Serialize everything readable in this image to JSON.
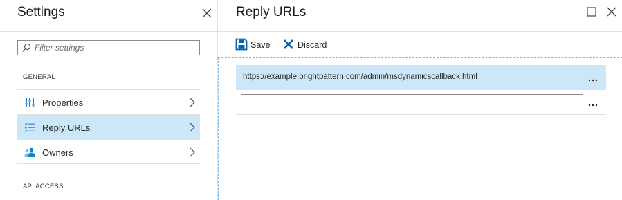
{
  "settings": {
    "title": "Settings",
    "filter_placeholder": "Filter settings",
    "general_label": "GENERAL",
    "api_access_label": "API ACCESS",
    "menu": [
      {
        "label": "Properties",
        "icon": "properties-icon",
        "selected": false
      },
      {
        "label": "Reply URLs",
        "icon": "list-icon",
        "selected": true
      },
      {
        "label": "Owners",
        "icon": "owners-icon",
        "selected": false
      }
    ]
  },
  "reply_urls": {
    "title": "Reply URLs",
    "toolbar": {
      "save_label": "Save",
      "discard_label": "Discard"
    },
    "urls": [
      {
        "value": "https://example.brightpattern.com/admin/msdynamicscallback.html"
      }
    ],
    "new_url_value": "",
    "ellipsis": "..."
  },
  "colors": {
    "accent": "#0072c6",
    "selected_bg": "#cce8f8",
    "owners_icon": "#0f86c8",
    "properties_icon": "#2b7cd3"
  }
}
